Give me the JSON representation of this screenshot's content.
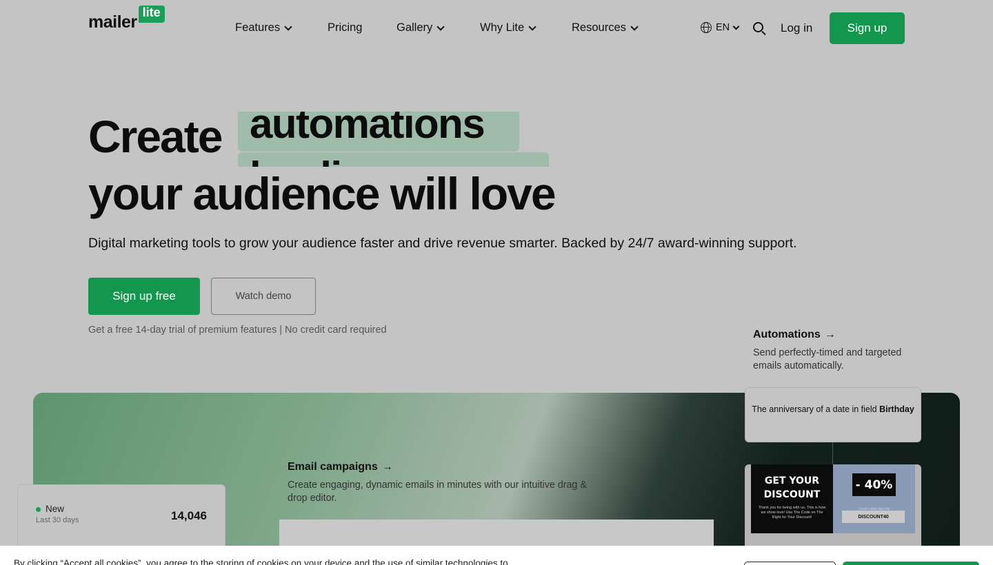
{
  "nav": {
    "logo_word": "mailer",
    "logo_badge": "lite",
    "items": [
      {
        "label": "Features",
        "dropdown": true
      },
      {
        "label": "Pricing",
        "dropdown": false
      },
      {
        "label": "Gallery",
        "dropdown": true
      },
      {
        "label": "Why Lite",
        "dropdown": true
      },
      {
        "label": "Resources",
        "dropdown": true
      }
    ],
    "language": "EN",
    "login_label": "Log in",
    "signup_label": "Sign up"
  },
  "hero": {
    "line1": "Create",
    "rotating_word": "automations",
    "rotating_word_next": "landing",
    "line2": "your audience will love",
    "subtitle": "Digital marketing tools to grow your audience faster and drive revenue smarter. Backed by 24/7 award-winning support.",
    "primary_cta": "Sign up free",
    "secondary_cta": "Watch demo",
    "trial_note": "Get a free 14-day trial of premium features | No credit card required"
  },
  "features": {
    "automations": {
      "title": "Automations",
      "arrow": "→",
      "description": "Send perfectly-timed and targeted emails automatically."
    },
    "email_campaigns": {
      "title": "Email campaigns",
      "arrow": "→",
      "description": "Create engaging, dynamic emails in minutes with our intuitive drag & drop editor."
    }
  },
  "stats_card": {
    "label": "New",
    "sublabel": "Last 30 days",
    "value": "14,046"
  },
  "trigger_card": {
    "text": "The anniversary of a date in field",
    "field": "Birthday"
  },
  "promo": {
    "heading_line1": "GET YOUR",
    "heading_line2": "DISCOUNT",
    "small_text": "Thank you for being with us. This is how we show love! Use The Code on The Right for Your Discount!",
    "badge": "- 40%",
    "code_label": "YOUR CODE BELOW",
    "code": "DISCOUNT40"
  },
  "cookie": {
    "text": "By clicking “Accept all cookies”, you agree to the storing of cookies on your device and the use of similar technologies to"
  },
  "colors": {
    "brand_green": "#13974f",
    "highlight": "#9fbcab",
    "overlay_bg": "#c4c4c4"
  }
}
